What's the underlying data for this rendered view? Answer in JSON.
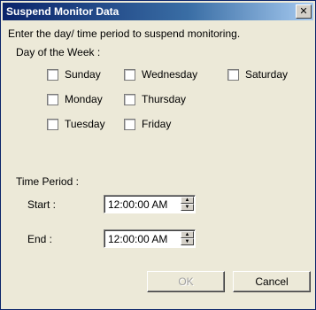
{
  "window": {
    "title": "Suspend Monitor Data",
    "close_glyph": "✕"
  },
  "instructions": "Enter the day/ time period to suspend monitoring.",
  "days_group": {
    "label": "Day of the Week :",
    "days": [
      "Sunday",
      "Wednesday",
      "Saturday",
      "Monday",
      "Thursday",
      "Tuesday",
      "Friday"
    ],
    "checked": []
  },
  "time_period": {
    "label": "Time Period :",
    "start_label": "Start :",
    "start_value": "12:00:00 AM",
    "end_label": "End :",
    "end_value": "12:00:00 AM"
  },
  "buttons": {
    "ok": "OK",
    "cancel": "Cancel"
  },
  "colors": {
    "titlebar": "#0a246a",
    "dialog_bg": "#ece9d8",
    "disabled_text": "#a0a0a0"
  }
}
